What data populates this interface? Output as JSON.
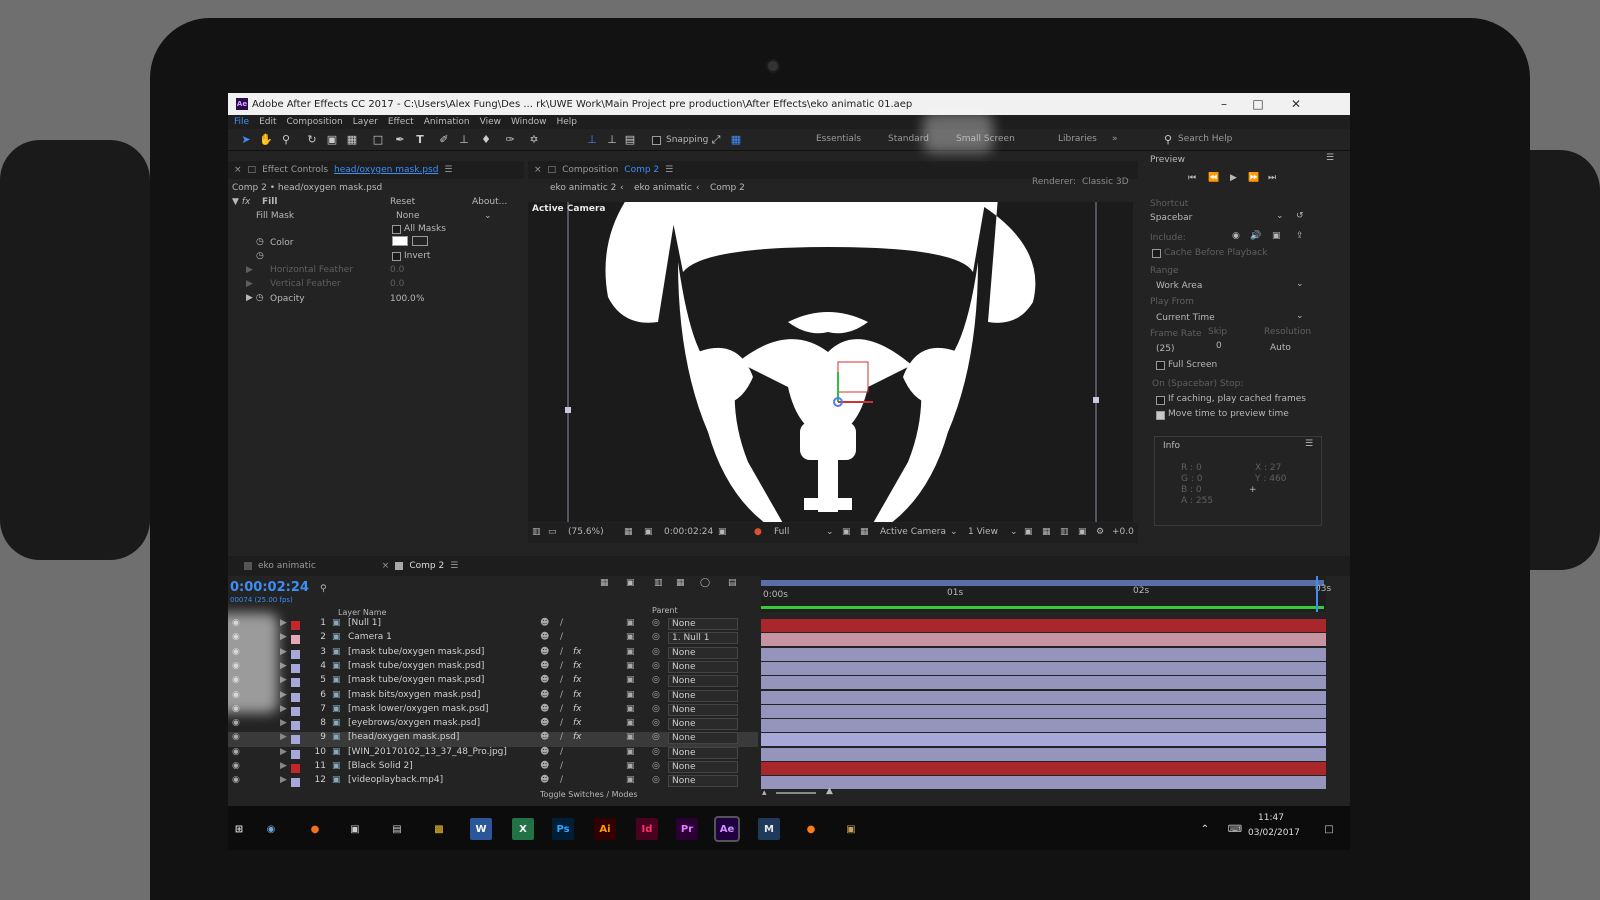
{
  "window": {
    "title": "Adobe After Effects CC 2017 - C:\\Users\\Alex Fung\\Des ... rk\\UWE Work\\Main Project pre production\\After Effects\\eko animatic 01.aep",
    "app_icon": "Ae"
  },
  "menu": [
    "File",
    "Edit",
    "Composition",
    "Layer",
    "Effect",
    "Animation",
    "View",
    "Window",
    "Help"
  ],
  "toolbar": {
    "snapping_label": "Snapping",
    "workspaces": [
      "Essentials",
      "Standard",
      "Small Screen",
      "Libraries"
    ],
    "search_placeholder": "Search Help"
  },
  "effect_controls": {
    "tab_label": "Effect Controls",
    "tab_layer": "head/oxygen mask.psd",
    "breadcrumb": "Comp 2 • head/oxygen mask.psd",
    "effect_name": "Fill",
    "reset_label": "Reset",
    "about_label": "About...",
    "fill_mask_label": "Fill Mask",
    "fill_mask_value": "None",
    "all_masks_label": "All Masks",
    "color_label": "Color",
    "invert_label": "Invert",
    "horizontal_feather_label": "Horizontal Feather",
    "horizontal_feather_value": "0.0",
    "vertical_feather_label": "Vertical Feather",
    "vertical_feather_value": "0.0",
    "opacity_label": "Opacity",
    "opacity_value": "100.0",
    "opacity_unit": "%",
    "fill_color": "#ffffff"
  },
  "composition": {
    "tab_label": "Composition",
    "tab_comp": "Comp 2",
    "crumbs": [
      "eko animatic 2",
      "eko animatic",
      "Comp 2"
    ],
    "renderer_label": "Renderer:",
    "renderer_value": "Classic 3D",
    "view_label": "Active Camera",
    "zoom": "(75.6%)",
    "timecode": "0:00:02:24",
    "resolution": "Full",
    "camera": "Active Camera",
    "views": "1 View",
    "exposure": "+0.0"
  },
  "preview": {
    "title": "Preview",
    "shortcut_label": "Shortcut",
    "shortcut_value": "Spacebar",
    "include_label": "Include:",
    "cache_label": "Cache Before Playback",
    "range_label": "Range",
    "range_value": "Work Area",
    "play_from_label": "Play From",
    "play_from_value": "Current Time",
    "frame_rate_label": "Frame Rate",
    "frame_rate_value": "(25)",
    "skip_label": "Skip",
    "skip_value": "0",
    "resolution_label": "Resolution",
    "resolution_value": "Auto",
    "full_screen_label": "Full Screen",
    "on_stop_label": "On (Spacebar) Stop:",
    "if_caching_label": "If caching, play cached frames",
    "move_time_label": "Move time to preview time",
    "move_time_checked": true
  },
  "info": {
    "title": "Info",
    "r": "R : 0",
    "g": "G : 0",
    "b": "B : 0",
    "a": "A : 255",
    "x": "X : 27",
    "y": "Y : 460"
  },
  "timeline": {
    "tabs": [
      "eko animatic",
      "Comp 2"
    ],
    "timecode": "0:00:02:24",
    "frame_info": "00074 (25.00 fps)",
    "layer_name_header": "Layer Name",
    "parent_header": "Parent",
    "ruler": [
      "0:00s",
      "01s",
      "02s",
      "03s"
    ],
    "toggle_label": "Toggle Switches / Modes",
    "layers": [
      {
        "num": "1",
        "name": "[Null 1]",
        "color": "#c0282c",
        "parent": "None",
        "fx": false
      },
      {
        "num": "2",
        "name": "Camera 1",
        "color": "#e4a8b8",
        "parent": "1. Null 1",
        "fx": false
      },
      {
        "num": "3",
        "name": "[mask tube/oxygen mask.psd]",
        "color": "#a8a8d8",
        "parent": "None",
        "fx": true
      },
      {
        "num": "4",
        "name": "[mask tube/oxygen mask.psd]",
        "color": "#a8a8d8",
        "parent": "None",
        "fx": true
      },
      {
        "num": "5",
        "name": "[mask tube/oxygen mask.psd]",
        "color": "#a8a8d8",
        "parent": "None",
        "fx": true
      },
      {
        "num": "6",
        "name": "[mask bits/oxygen mask.psd]",
        "color": "#a8a8d8",
        "parent": "None",
        "fx": true
      },
      {
        "num": "7",
        "name": "[mask lower/oxygen mask.psd]",
        "color": "#a8a8d8",
        "parent": "None",
        "fx": true
      },
      {
        "num": "8",
        "name": "[eyebrows/oxygen mask.psd]",
        "color": "#a8a8d8",
        "parent": "None",
        "fx": true
      },
      {
        "num": "9",
        "name": "[head/oxygen mask.psd]",
        "color": "#a8a8d8",
        "parent": "None",
        "fx": true
      },
      {
        "num": "10",
        "name": "[WIN_20170102_13_37_48_Pro.jpg]",
        "color": "#a8a8d8",
        "parent": "None",
        "fx": false
      },
      {
        "num": "11",
        "name": "[Black Solid 2]",
        "color": "#c0282c",
        "parent": "None",
        "fx": false
      },
      {
        "num": "12",
        "name": "[videoplayback.mp4]",
        "color": "#a8a8d8",
        "parent": "None",
        "fx": false
      }
    ]
  },
  "taskbar": {
    "apps": [
      "Ps",
      "Ai",
      "Id",
      "Pr",
      "Ae",
      "M"
    ],
    "time": "11:47",
    "date": "03/02/2017"
  }
}
